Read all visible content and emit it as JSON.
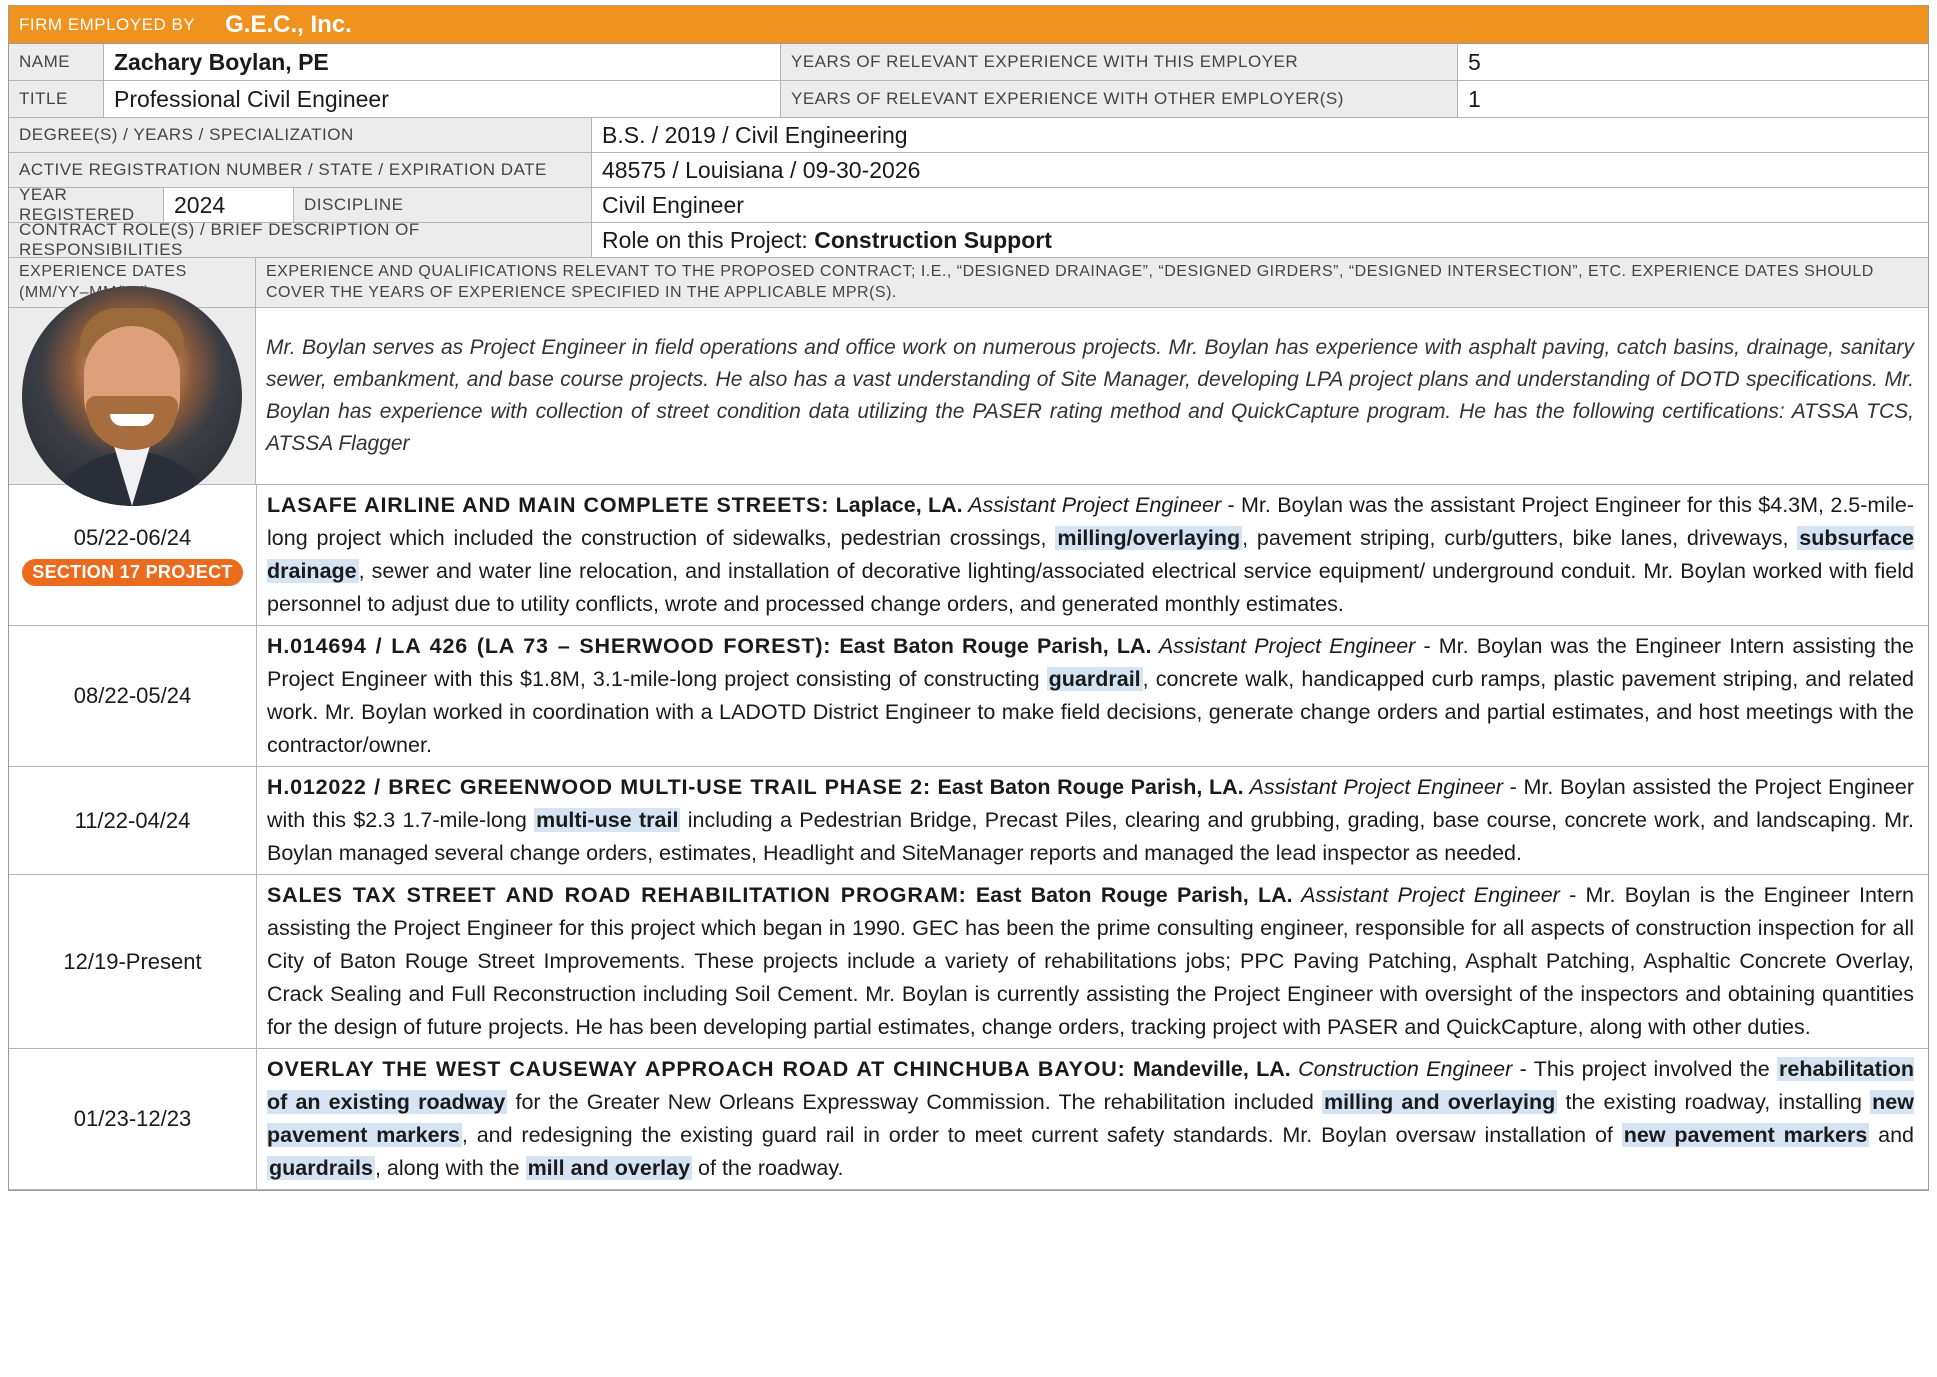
{
  "header": {
    "firm_label": "FIRM EMPLOYED BY",
    "firm_name": "G.E.C., Inc."
  },
  "name": {
    "label": "NAME",
    "value": "Zachary Boylan, PE"
  },
  "title": {
    "label": "TITLE",
    "value": "Professional Civil Engineer"
  },
  "years_this": {
    "label": "YEARS OF RELEVANT EXPERIENCE WITH THIS EMPLOYER",
    "value": "5"
  },
  "years_other": {
    "label": "YEARS OF RELEVANT EXPERIENCE WITH OTHER EMPLOYER(S)",
    "value": "1"
  },
  "degree": {
    "label": "DEGREE(S) / YEARS / SPECIALIZATION",
    "value": "B.S. / 2019 / Civil Engineering"
  },
  "registration": {
    "label": "ACTIVE REGISTRATION NUMBER / STATE / EXPIRATION DATE",
    "value": "48575 / Louisiana / 09-30-2026"
  },
  "year_registered": {
    "label": "YEAR REGISTERED",
    "value": "2024"
  },
  "discipline": {
    "label": "DISCIPLINE",
    "value": "Civil Engineer"
  },
  "role": {
    "label": "CONTRACT ROLE(S) / BRIEF DESCRIPTION OF RESPONSIBILITIES",
    "prefix": "Role on this Project: ",
    "value": "Construction Support"
  },
  "exp_header": {
    "dates_label": "EXPERIENCE DATES (MM/YY–MM/YY)",
    "desc_label": "EXPERIENCE AND QUALIFICATIONS RELEVANT TO THE PROPOSED CONTRACT; I.E., “DESIGNED DRAINAGE”, “DESIGNED GIRDERS”, “DESIGNED INTERSECTION”, ETC. EXPERIENCE DATES SHOULD COVER THE YEARS OF EXPERIENCE SPECIFIED IN THE APPLICABLE MPR(S)."
  },
  "bio": "Mr. Boylan serves as Project Engineer in field operations and office work on numerous projects. Mr. Boylan has experience with asphalt paving, catch basins, drainage, sanitary sewer, embankment, and base course projects. He also has a vast understanding of Site Manager, developing LPA project plans and understanding of DOTD specifications. Mr. Boylan has experience with collection of street condition data utilizing the PASER rating method and QuickCapture program. He has the following certifications: ATSSA TCS, ATSSA Flagger",
  "projects": [
    {
      "dates": "05/22-06/24",
      "badge": "SECTION 17 PROJECT",
      "title": "LASAFE AIRLINE AND MAIN COMPLETE STREETS:",
      "location": " Laplace, LA.",
      "role": " Assistant Project Engineer",
      "segments": [
        {
          "t": " - Mr. Boylan was the assistant Project Engineer for this $4.3M, 2.5-mile-long project which included the construction of sidewalks, pedestrian crossings, ",
          "h": false
        },
        {
          "t": "milling/overlaying",
          "h": true
        },
        {
          "t": ", pavement striping, curb/gutters, bike lanes, driveways, ",
          "h": false
        },
        {
          "t": "subsurface drainage",
          "h": true
        },
        {
          "t": ", sewer and water line relocation, and installation of decorative lighting/associated electrical service equipment/ underground conduit. Mr. Boylan worked with field personnel to adjust due to utility conflicts, wrote and processed change orders, and generated monthly estimates.",
          "h": false
        }
      ]
    },
    {
      "dates": "08/22-05/24",
      "title": "H.014694 / LA 426 (LA 73 – SHERWOOD FOREST):",
      "location": " East Baton Rouge Parish, LA.",
      "role": " Assistant Project Engineer",
      "segments": [
        {
          "t": " - Mr. Boylan was the Engineer Intern assisting the Project Engineer with this $1.8M, 3.1-mile-long project consisting of constructing ",
          "h": false
        },
        {
          "t": "guardrail",
          "h": true
        },
        {
          "t": ", concrete walk, handicapped curb ramps, plastic pavement striping, and related work. Mr. Boylan worked in coordination with a LADOTD District Engineer to make field decisions, generate change orders and partial estimates, and host meetings with the contractor/owner.",
          "h": false
        }
      ]
    },
    {
      "dates": "11/22-04/24",
      "title": "H.012022 / BREC GREENWOOD MULTI-USE TRAIL PHASE 2:",
      "location": " East Baton Rouge Parish, LA.",
      "role": " Assistant Project Engineer",
      "segments": [
        {
          "t": " - Mr. Boylan assisted the Project Engineer with this $2.3 1.7-mile-long ",
          "h": false
        },
        {
          "t": "multi-use trail",
          "h": true
        },
        {
          "t": " including a Pedestrian Bridge, Precast Piles, clearing and grubbing, grading, base course, concrete work, and landscaping. Mr. Boylan managed several change orders, estimates, Headlight and SiteManager reports and managed the lead inspector as needed.",
          "h": false
        }
      ]
    },
    {
      "dates": "12/19-Present",
      "title": "SALES TAX STREET AND ROAD REHABILITATION PROGRAM:",
      "location": " East Baton Rouge Parish, LA.",
      "role": " Assistant Project Engineer",
      "segments": [
        {
          "t": " - Mr. Boylan is the Engineer Intern assisting the Project Engineer for this project which began in 1990. GEC has been the prime consulting engineer, responsible for all aspects of construction inspection for all City of Baton Rouge Street Improvements. These projects include a variety of rehabilitations jobs; PPC Paving Patching, Asphalt Patching, Asphaltic Concrete Overlay, Crack Sealing and Full Reconstruction including Soil Cement. Mr. Boylan is currently assisting the Project Engineer with oversight of the inspectors and obtaining quantities for the design of future projects. He has been developing partial estimates, change orders, tracking project with PASER and QuickCapture, along with other duties.",
          "h": false
        }
      ]
    },
    {
      "dates": "01/23-12/23",
      "title": "OVERLAY THE WEST CAUSEWAY APPROACH ROAD AT CHINCHUBA BAYOU:",
      "location": " Mandeville, LA.",
      "role": " Construction Engineer",
      "segments": [
        {
          "t": " - This project involved the ",
          "h": false
        },
        {
          "t": "rehabilitation of an existing roadway",
          "h": true
        },
        {
          "t": " for the Greater New Orleans Expressway Commission. The rehabilitation included ",
          "h": false
        },
        {
          "t": "milling and overlaying",
          "h": true
        },
        {
          "t": " the existing roadway, installing ",
          "h": false
        },
        {
          "t": "new pavement markers",
          "h": true
        },
        {
          "t": ", and redesigning the existing guard rail in order to meet current safety standards. Mr. Boylan oversaw installation of ",
          "h": false
        },
        {
          "t": "new pavement markers",
          "h": true
        },
        {
          "t": " and ",
          "h": false
        },
        {
          "t": "guardrails",
          "h": true
        },
        {
          "t": ", along with the ",
          "h": false
        },
        {
          "t": "mill and overlay",
          "h": true
        },
        {
          "t": " of the roadway.",
          "h": false
        }
      ]
    }
  ]
}
